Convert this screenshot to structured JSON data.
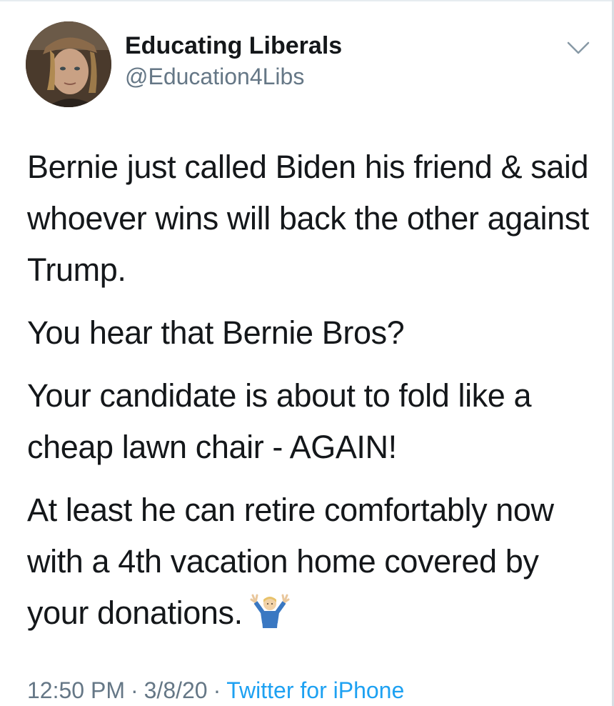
{
  "tweet": {
    "author": {
      "display_name": "Educating Liberals",
      "handle": "@Education4Libs",
      "avatar_icon": "profile-photo"
    },
    "menu_icon": "chevron-down-icon",
    "paragraphs": [
      "Bernie just called Biden his friend & said whoever wins will back the other against Trump.",
      "You hear that Bernie Bros?",
      "Your candidate is about to fold like a cheap lawn chair - AGAIN!",
      "At least he can retire comfortably now with a 4th vacation home covered by your donations."
    ],
    "emoji": "person-shrugging",
    "time": "12:50 PM",
    "separator": "·",
    "date": "3/8/20",
    "source": "Twitter for iPhone"
  },
  "colors": {
    "text": "#14171a",
    "secondary": "#657786",
    "link": "#1da1f2"
  }
}
